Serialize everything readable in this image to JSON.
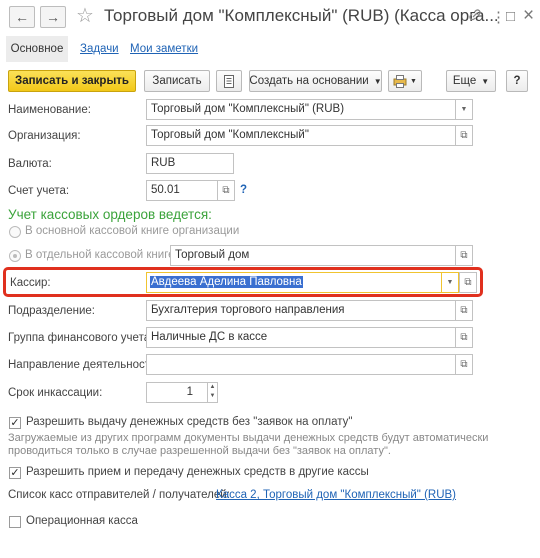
{
  "window": {
    "title": "Торговый дом \"Комплексный\" (RUB) (Касса орга...",
    "back_icon": "←",
    "forward_icon": "→",
    "star_icon": "☆",
    "link_icon": "🔗",
    "more_icon": "⋮",
    "maximize_icon": "□",
    "close_icon": "×"
  },
  "tabs": [
    "Основное",
    "Задачи",
    "Мои заметки"
  ],
  "toolbar": {
    "save_close": "Записать и закрыть",
    "save": "Записать",
    "create_based": "Создать на основании",
    "more": "Еще",
    "help": "?"
  },
  "fields": {
    "name_label": "Наименование:",
    "name_value": "Торговый дом \"Комплексный\" (RUB)",
    "org_label": "Организация:",
    "org_value": "Торговый дом \"Комплексный\"",
    "currency_label": "Валюта:",
    "currency_value": "RUB",
    "account_label": "Счет учета:",
    "account_value": "50.01",
    "account_help": "?",
    "section_heading": "Учет кассовых ордеров ведется:",
    "radio_main": "В основной кассовой книге организации",
    "radio_separate": "В отдельной кассовой книге",
    "separate_value": "Торговый дом",
    "cashier_label": "Кассир:",
    "cashier_value": "Авдеева Аделина Павловна",
    "division_label": "Подразделение:",
    "division_value": "Бухгалтерия торгового направления",
    "fin_group_label": "Группа финансового учета:",
    "fin_group_value": "Наличные ДС в кассе",
    "direction_label": "Направление деятельности:",
    "direction_value": "",
    "collection_label": "Срок инкассации:",
    "collection_value": "1"
  },
  "options": {
    "allow_issue": "Разрешить выдачу денежных средств без \"заявок на оплату\"",
    "allow_issue_note": "Загружаемые из других программ документы выдачи денежных средств будут автоматически проводиться только в случае разрешенной выдачи без \"заявок на оплату\".",
    "allow_transfer": "Разрешить прием и передачу денежных средств в другие кассы",
    "list_label": "Список касс отправителей / получателей:",
    "list_link": "Касса 2, Торговый дом \"Комплексный\" (RUB)",
    "operational": "Операционная касса"
  },
  "colors": {
    "primary_button": "#f2c818",
    "highlight_frame": "#e0301e",
    "section_heading": "#3ba33b",
    "link": "#1f63b5",
    "selection": "#3a6fd0"
  }
}
